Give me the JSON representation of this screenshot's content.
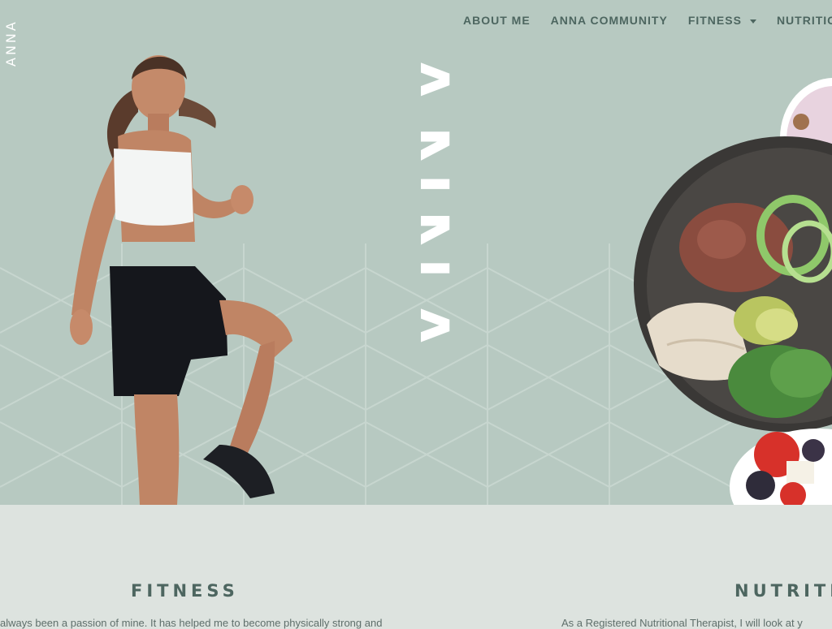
{
  "brand": {
    "side_logo": "ANNA",
    "big_word": "ANNA"
  },
  "nav": {
    "items": [
      {
        "label": "ABOUT ME"
      },
      {
        "label": "ANNA COMMUNITY"
      },
      {
        "label": "FITNESS",
        "has_dropdown": true,
        "dropdown_icon": "caret-down-icon"
      },
      {
        "label": "NUTRITIC"
      }
    ]
  },
  "hero": {
    "runner_image": "woman-running-photo",
    "food_image": "salad-bowls-photo"
  },
  "sections": {
    "fitness": {
      "title": "FITNESS",
      "text": "always been a passion of mine. It has helped me to become physically strong and"
    },
    "nutrition": {
      "title": "NUTRITIC",
      "text": "As a Registered Nutritional Therapist, I will look at y"
    }
  },
  "colors": {
    "hero_bg": "#b7c9c1",
    "page_bg": "#dde3df",
    "accent_text": "#4d6660"
  }
}
